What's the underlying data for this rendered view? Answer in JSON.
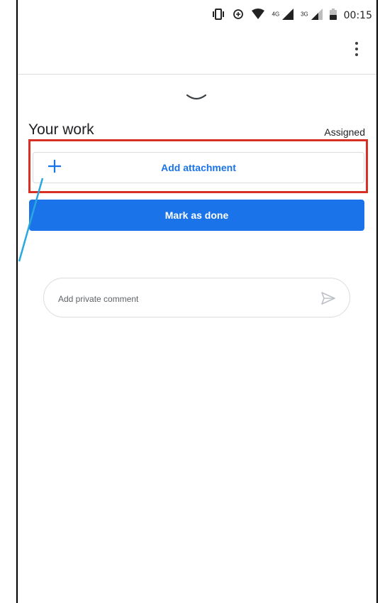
{
  "status_bar": {
    "time": "00:15",
    "network_4g": "4G",
    "network_3g": "3G",
    "icons": [
      "vibrate-icon",
      "data-saver-icon",
      "wifi-icon",
      "signal-4g-icon",
      "signal-3g-icon",
      "battery-icon"
    ]
  },
  "toolbar": {
    "menu_icon": "more-vert-icon"
  },
  "sheet": {
    "collapse_icon": "chevron-down-icon"
  },
  "your_work": {
    "title": "Your work",
    "status": "Assigned",
    "add_attachment_label": "Add attachment",
    "add_icon": "plus-icon",
    "mark_done_label": "Mark as done"
  },
  "comment": {
    "placeholder": "Add private comment",
    "send_icon": "send-icon"
  },
  "colors": {
    "accent": "#1a73e8",
    "highlight": "#d93025",
    "annotation_line": "#29a8e0",
    "divider": "#dadce0"
  }
}
